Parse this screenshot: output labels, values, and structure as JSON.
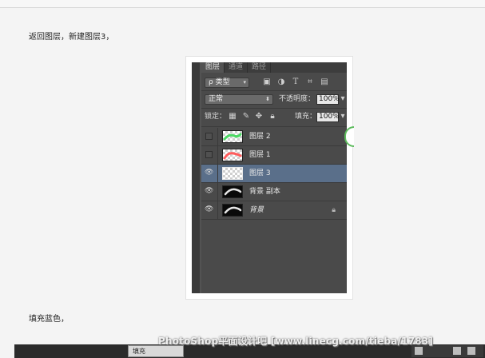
{
  "article": {
    "paragraph_1": "返回图层，新建图层3，",
    "paragraph_2": "填充蓝色，"
  },
  "layers_panel": {
    "tabs": [
      "图层",
      "通道",
      "路径"
    ],
    "filter_label": "ρ 类型",
    "blend_mode": "正常",
    "opacity_label": "不透明度：",
    "opacity_value": "100%",
    "lock_label": "锁定：",
    "fill_label": "填充：",
    "fill_value": "100%",
    "layers": [
      {
        "name": "图层 2",
        "visible": false,
        "thumb": "transparent-green-stroke",
        "selected": false,
        "locked": false
      },
      {
        "name": "图层 1",
        "visible": false,
        "thumb": "transparent-red-stroke",
        "selected": false,
        "locked": false
      },
      {
        "name": "图层 3",
        "visible": true,
        "thumb": "transparent",
        "selected": true,
        "locked": false
      },
      {
        "name": "背景 副本",
        "visible": true,
        "thumb": "black-white-stroke",
        "selected": false,
        "locked": false
      },
      {
        "name": "背景",
        "visible": true,
        "thumb": "black-white-stroke",
        "selected": false,
        "locked": true
      }
    ],
    "colors": {
      "panel_bg": "#4a4a4a",
      "selected_row": "#5a6f8a",
      "green_stroke": "#4cd964",
      "red_stroke": "#ff5c5c"
    }
  },
  "bottom": {
    "tab_label": "填充",
    "watermark": "PhotoShop平面设计吧 [www.linecg.com/tieba/1783]"
  }
}
